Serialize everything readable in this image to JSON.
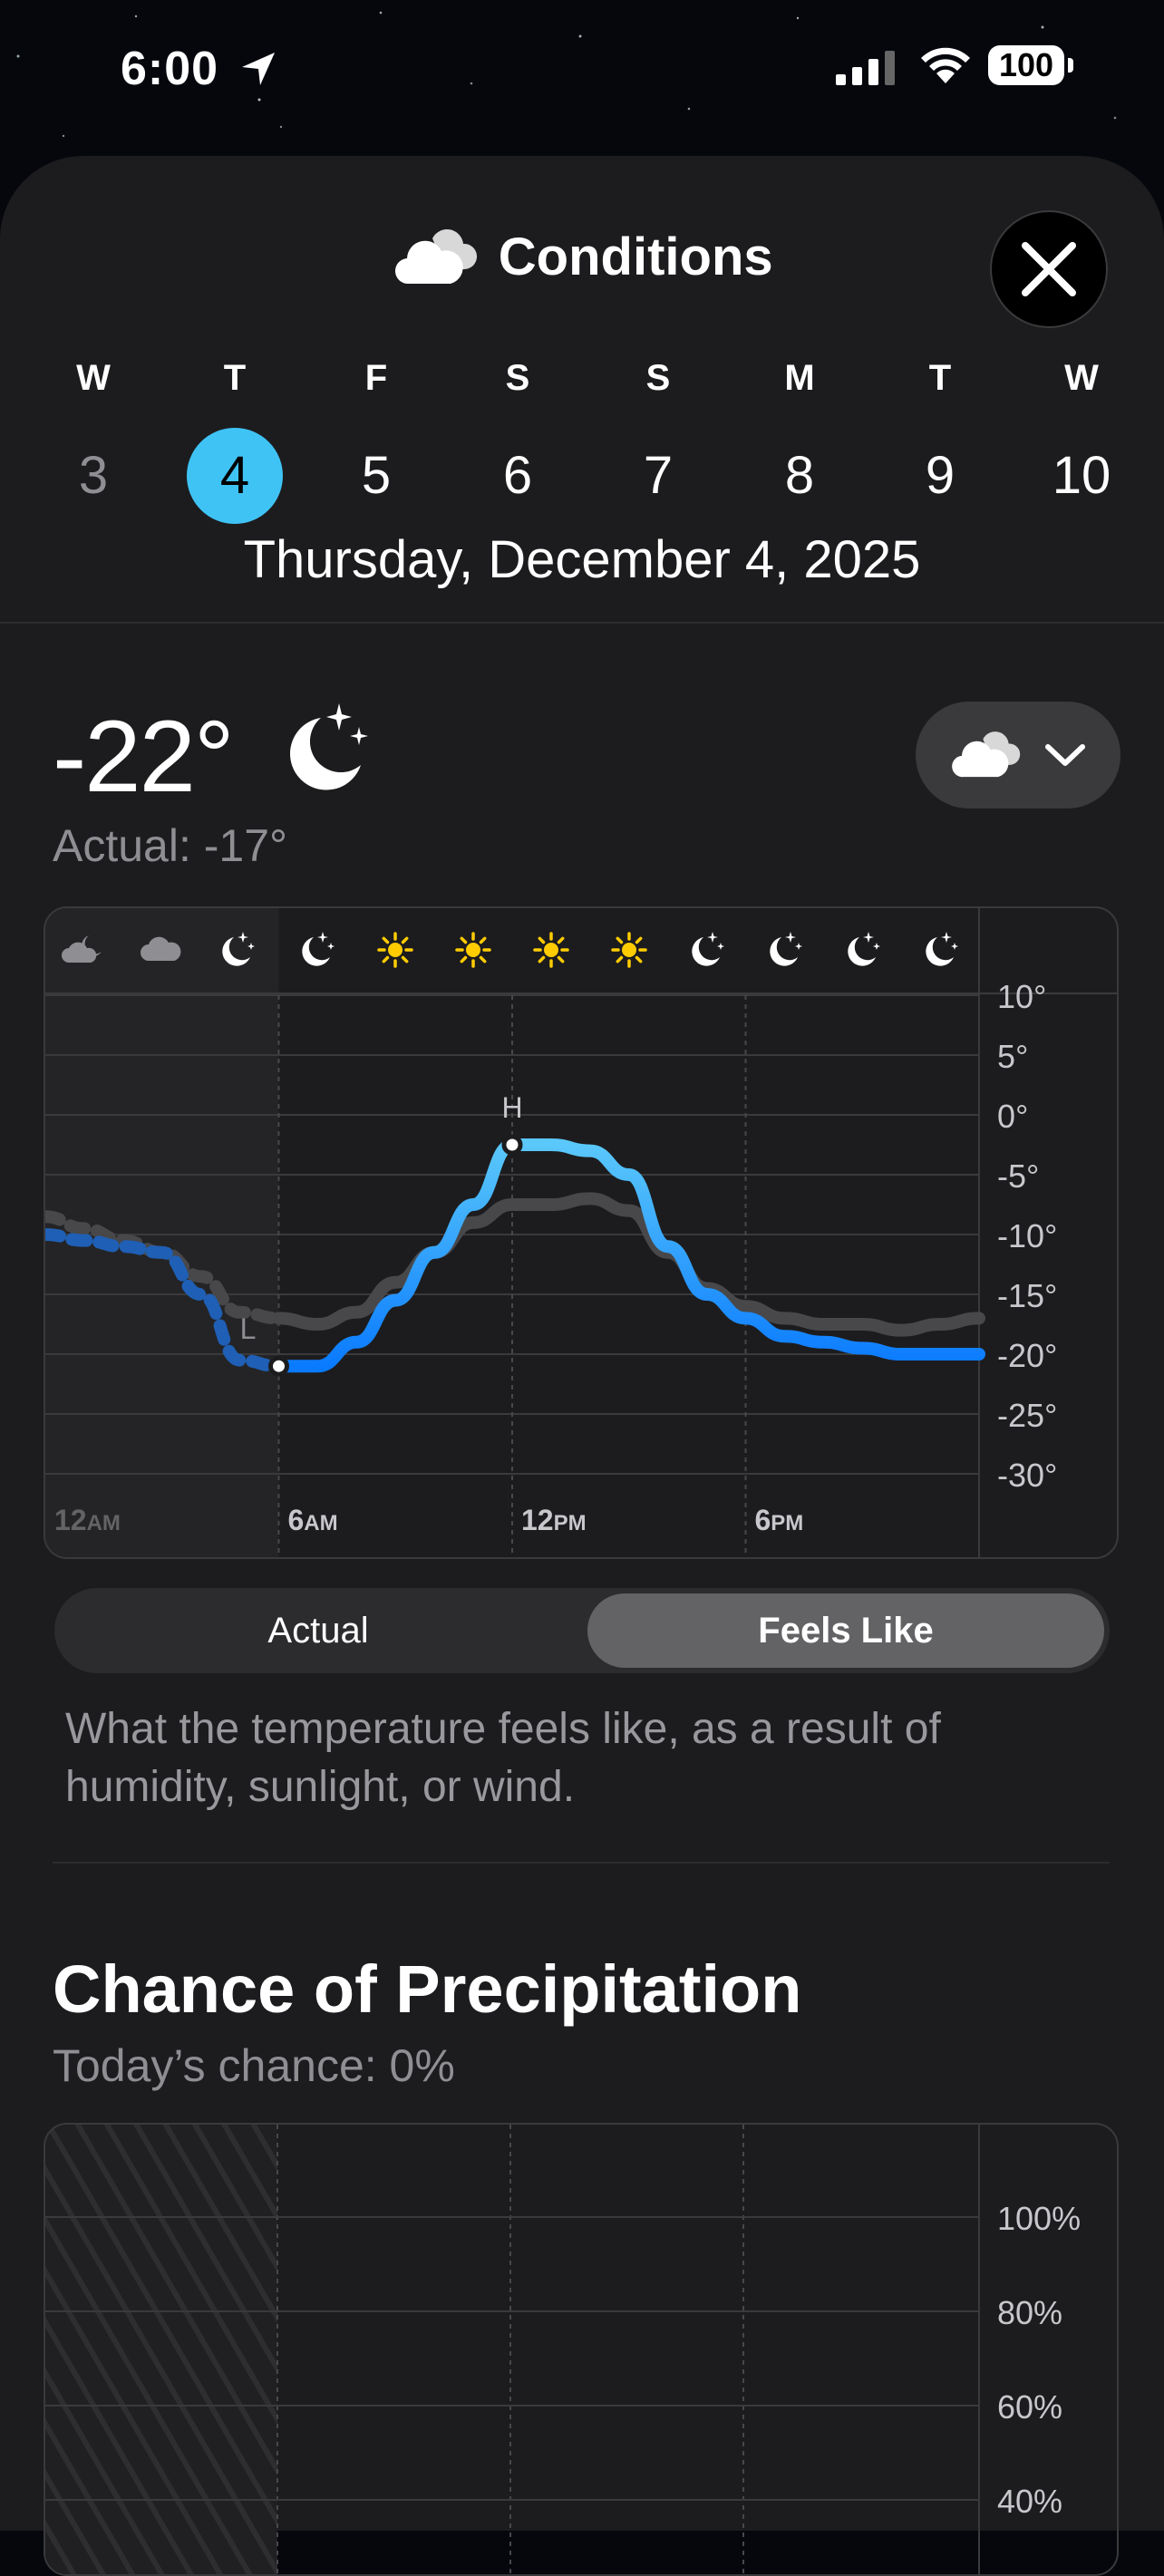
{
  "status_bar": {
    "time": "6:00",
    "battery": "100"
  },
  "header": {
    "title": "Conditions",
    "title_icon": "cloud-icon",
    "close_icon": "close-icon"
  },
  "days": [
    {
      "letter": "W",
      "num": "3",
      "state": "past"
    },
    {
      "letter": "T",
      "num": "4",
      "state": "selected"
    },
    {
      "letter": "F",
      "num": "5",
      "state": "future"
    },
    {
      "letter": "S",
      "num": "6",
      "state": "future"
    },
    {
      "letter": "S",
      "num": "7",
      "state": "future"
    },
    {
      "letter": "M",
      "num": "8",
      "state": "future"
    },
    {
      "letter": "T",
      "num": "9",
      "state": "future"
    },
    {
      "letter": "W",
      "num": "10",
      "state": "future"
    }
  ],
  "selected_date": "Thursday, December 4, 2025",
  "current": {
    "temp": "-22°",
    "icon": "moon-stars-icon",
    "actual": "Actual: -17°",
    "dropdown_icon": "cloud-icon"
  },
  "temp_chart": {
    "hour_icons": [
      "cloud-moon-icon",
      "cloud-icon",
      "moon-stars-icon",
      "moon-stars-icon",
      "sun-icon",
      "sun-icon",
      "sun-icon",
      "sun-icon",
      "moon-stars-icon",
      "moon-stars-icon",
      "moon-stars-icon",
      "moon-stars-icon"
    ],
    "y_ticks": [
      "10°",
      "5°",
      "0°",
      "-5°",
      "-10°",
      "-15°",
      "-20°",
      "-25°",
      "-30°"
    ],
    "x_ticks": [
      {
        "num": "12",
        "ampm": "AM"
      },
      {
        "num": "6",
        "ampm": "AM"
      },
      {
        "num": "12",
        "ampm": "PM"
      },
      {
        "num": "6",
        "ampm": "PM"
      }
    ],
    "high_label": "H",
    "low_label": "L",
    "colors": {
      "feels_like_light": "#5ac8fa",
      "feels_like_dark": "#0a7aff",
      "actual": "#48484a"
    }
  },
  "chart_data": {
    "type": "line",
    "x": [
      0,
      1,
      2,
      3,
      4,
      5,
      6,
      7,
      8,
      9,
      10,
      11,
      12,
      13,
      14,
      15,
      16,
      17,
      18,
      19,
      20,
      21,
      22,
      23,
      24
    ],
    "xlabel": "",
    "ylabel": "",
    "ylim": [
      -30,
      10
    ],
    "series": [
      {
        "values": [
          -10,
          -10.5,
          -11,
          -11.5,
          -15,
          -20.5,
          -21,
          -21,
          -19,
          -15.5,
          -11.5,
          -7.5,
          -2.5,
          -2.5,
          -3,
          -5,
          -11,
          -15,
          -17,
          -18.5,
          -19,
          -19.5,
          -20,
          -20,
          -20
        ]
      },
      {
        "values": [
          -8.5,
          -9.5,
          -10.5,
          -11.5,
          -13.5,
          -16.5,
          -17,
          -17.5,
          -16.5,
          -14,
          -11.5,
          -9,
          -7.5,
          -7.5,
          -7,
          -8,
          -11.5,
          -14.5,
          -16,
          -17,
          -17.5,
          -17.5,
          -18,
          -17.5,
          -17
        ]
      }
    ]
  },
  "segmented": {
    "option_actual": "Actual",
    "option_feels": "Feels Like",
    "selected": "Feels Like"
  },
  "description": "What the temperature feels like, as a result of humidity, sunlight, or wind.",
  "precip": {
    "title": "Chance of Precipitation",
    "subtitle": "Today’s chance: 0%",
    "y_ticks": [
      "100%",
      "80%",
      "60%",
      "40%"
    ]
  }
}
